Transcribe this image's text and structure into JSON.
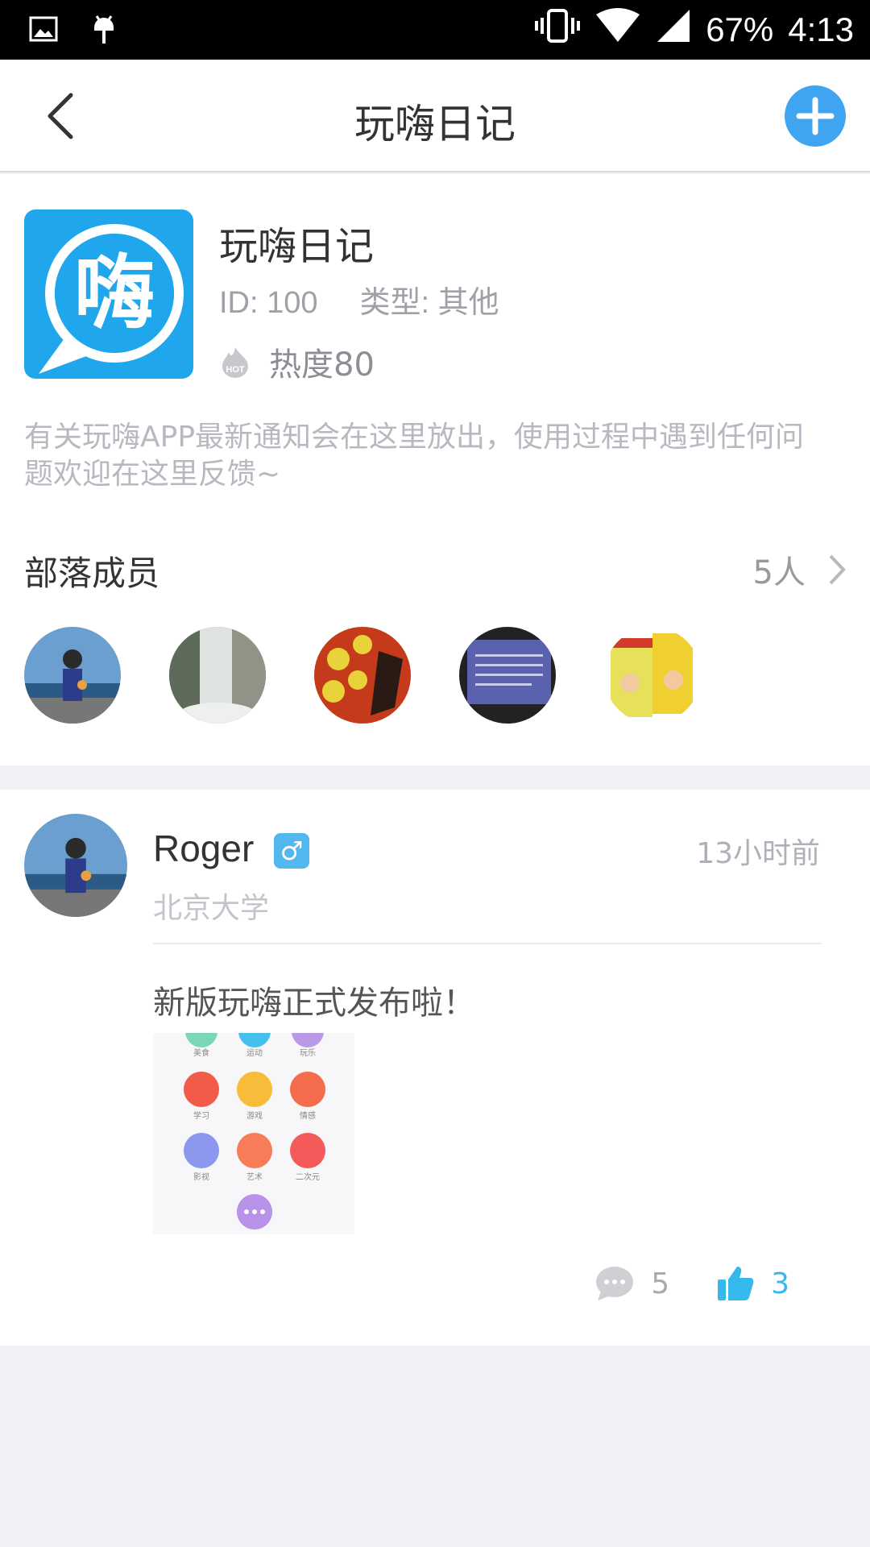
{
  "status_bar": {
    "battery": "67%",
    "time": "4:13"
  },
  "nav": {
    "title": "玩嗨日记"
  },
  "tribe": {
    "logo_char": "嗨",
    "name": "玩嗨日记",
    "id": "ID: 100",
    "type": "类型: 其他",
    "heat": "热度80",
    "hot_badge": "HOT",
    "description": "有关玩嗨APP最新通知会在这里放出，使用过程中遇到任何问题欢迎在这里反馈~",
    "members_title": "部落成员",
    "members_count": "5人"
  },
  "post": {
    "username": "Roger",
    "gender": "♂",
    "time": "13小时前",
    "school": "北京大学",
    "text": "新版玩嗨正式发布啦！",
    "image_labels": [
      "美食",
      "运动",
      "玩乐",
      "学习",
      "游戏",
      "情感",
      "影视",
      "艺术",
      "二次元"
    ],
    "comments": "5",
    "likes": "3"
  }
}
